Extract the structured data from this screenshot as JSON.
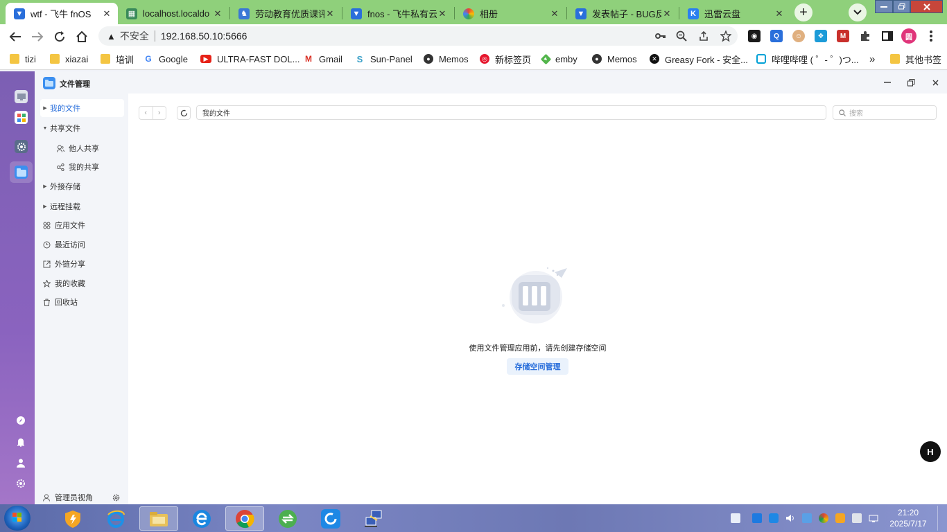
{
  "browser": {
    "tabs": [
      {
        "title": "wtf - 飞牛 fnOS",
        "icon": "fnos-icon",
        "color": "#2a6fdb",
        "active": true
      },
      {
        "title": "localhost.localdo",
        "icon": "page-icon",
        "color": "#3a8a5a",
        "active": false
      },
      {
        "title": "劳动教育优质课评",
        "icon": "edu-icon",
        "color": "#3a78d6",
        "active": false
      },
      {
        "title": "fnos - 飞牛私有云",
        "icon": "fnos-icon",
        "color": "#2a6fdb",
        "active": false
      },
      {
        "title": "相册",
        "icon": "photos-icon",
        "color": "#e0443a",
        "active": false
      },
      {
        "title": "发表帖子 - BUG反",
        "icon": "fnos-icon",
        "color": "#2a6fdb",
        "active": false
      },
      {
        "title": "迅雷云盘",
        "icon": "thunder-icon",
        "color": "#2a7ff0",
        "active": false
      }
    ],
    "tab_close_glyph": "✕",
    "new_tab_glyph": "+",
    "address": {
      "security_label": "不安全",
      "url": "192.168.50.10:5666"
    },
    "bookmarks": [
      {
        "label": "tizi",
        "icon": "folder-icon"
      },
      {
        "label": "xiazai",
        "icon": "folder-icon"
      },
      {
        "label": "培训",
        "icon": "folder-icon"
      },
      {
        "label": "Google",
        "icon": "google-icon"
      },
      {
        "label": "ULTRA-FAST DOL...",
        "icon": "youtube-icon"
      },
      {
        "label": "Gmail",
        "icon": "gmail-icon"
      },
      {
        "label": "Sun-Panel",
        "icon": "sunpanel-icon"
      },
      {
        "label": "Memos",
        "icon": "memos-icon"
      },
      {
        "label": "新标签页",
        "icon": "weibo-icon"
      },
      {
        "label": "emby",
        "icon": "emby-icon"
      },
      {
        "label": "Memos",
        "icon": "memos-icon"
      },
      {
        "label": "Greasy Fork - 安全...",
        "icon": "greasyfork-icon"
      },
      {
        "label": "哔哩哔哩 ( ゜- ゜)つ...",
        "icon": "bilibili-icon"
      }
    ],
    "bookmarks_overflow": "»",
    "other_bookmarks": "其他书签"
  },
  "app": {
    "title": "文件管理",
    "sidebar": [
      {
        "label": "我的文件",
        "arrow": "▶",
        "selected": true
      },
      {
        "label": "共享文件",
        "arrow": "▼",
        "selected": false
      },
      {
        "label": "他人共享",
        "icon": "users-icon",
        "sub": true
      },
      {
        "label": "我的共享",
        "icon": "share-icon",
        "sub": true
      },
      {
        "label": "外接存储",
        "arrow": "▶"
      },
      {
        "label": "远程挂载",
        "arrow": "▶"
      },
      {
        "label": "应用文件",
        "icon": "apps-icon"
      },
      {
        "label": "最近访问",
        "icon": "clock-icon"
      },
      {
        "label": "外链分享",
        "icon": "link-share-icon"
      },
      {
        "label": "我的收藏",
        "icon": "star-icon"
      },
      {
        "label": "回收站",
        "icon": "trash-icon"
      }
    ],
    "footer_label": "管理员视角",
    "path": "我的文件",
    "search_placeholder": "搜索",
    "empty_message": "使用文件管理应用前，请先创建存储空间",
    "empty_button": "存储空间管理",
    "floating_badge": "H"
  },
  "taskbar": {
    "time": "21:20",
    "date": "2025/7/17"
  }
}
